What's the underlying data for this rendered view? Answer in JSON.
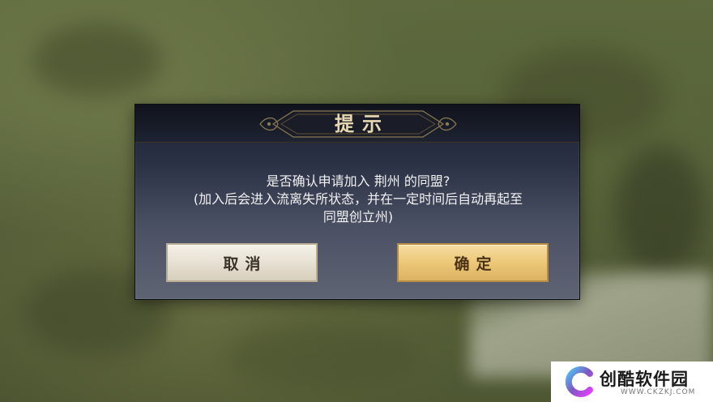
{
  "dialog": {
    "title": "提示",
    "message_line1": "是否确认申请加入 荆州 的同盟?",
    "message_line2": "(加入后会进入流离失所状态，并在一定时间后自动再起至",
    "message_line3": "同盟创立州)",
    "cancel_label": "取消",
    "confirm_label": "确定"
  },
  "watermark": {
    "name": "创酷软件园",
    "url": "WWW.CKZKJ.COM",
    "logo_icon": "c-logo-icon"
  },
  "colors": {
    "dialog_bg_top": "#1d2231",
    "dialog_bg_bottom": "#5f6474",
    "title_text": "#e7d8b2",
    "cancel_button": "#e7e1d3",
    "confirm_button": "#ecc878",
    "logo_gradient_start": "#4fc3f7",
    "logo_gradient_end": "#9c27b0"
  }
}
